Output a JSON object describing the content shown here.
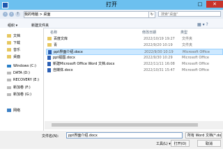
{
  "window": {
    "title": "打开"
  },
  "addressbar": {
    "breadcrumb": "我的电脑 > 桌面",
    "search_placeholder": "搜索\"桌面\""
  },
  "toolbar": {
    "organize": "组织 ▾",
    "new_folder": "新建文件夹"
  },
  "nav": {
    "items": [
      "文档",
      "下载",
      "音乐",
      "桌面",
      "Windows (C:)",
      "DATA (D:)",
      "RECOVERY (E:)",
      "新加卷 (F:)",
      "新加卷 (G:)",
      "网络"
    ]
  },
  "file_list": {
    "headers": [
      "名称",
      "修改日期",
      "类型"
    ],
    "files": [
      {
        "name": "百度文库",
        "date": "2022/10/19 19:27",
        "type": "文件夹"
      },
      {
        "name": "青",
        "date": "2022/9/20 10:19",
        "type": "文件夹"
      },
      {
        "name": "ppt界面介绍.docx",
        "date": "2022/9/30 10:19",
        "type": "Microsoft Office"
      },
      {
        "name": "ppt视图.docx",
        "date": "2022/9/30 10:29",
        "type": "Microsoft Office"
      },
      {
        "name": "新建Microsoft Office Word 文档.docx",
        "date": "2022/11/11 16:08",
        "type": "Microsoft Office"
      },
      {
        "name": "自媒体.docx",
        "date": "2022/10/31 15:47",
        "type": "Microsoft Office"
      }
    ]
  },
  "bottom": {
    "filename_label": "文件名(N):",
    "filename_value": "ppt界面介绍.docx",
    "filetype_value": "所有 Word 文档(*.docx;*.docm;*",
    "tools_label": "工具(L) ▾",
    "open_label": "打开(O)",
    "cancel_label": "取消"
  }
}
